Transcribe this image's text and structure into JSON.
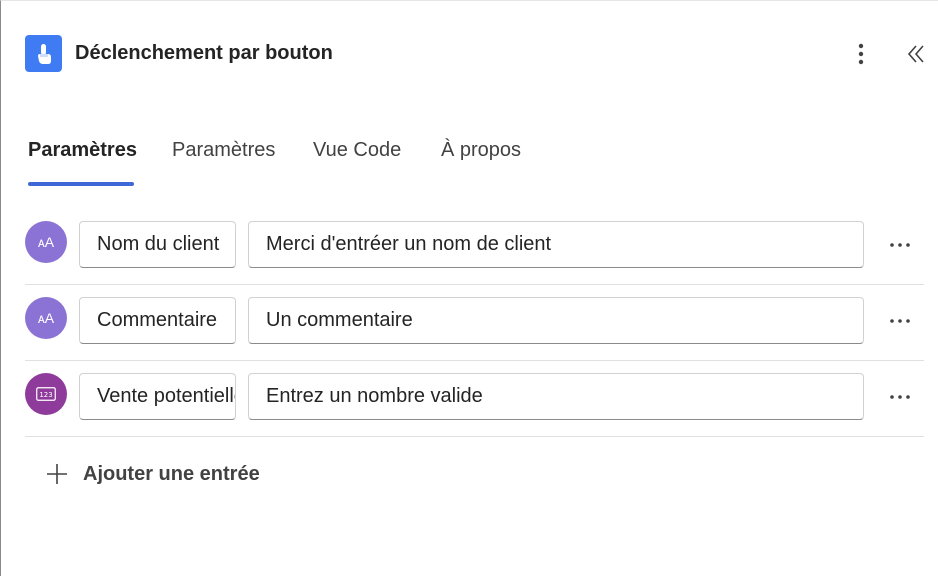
{
  "header": {
    "title": "Déclenchement par bouton",
    "icon": "touch-hand-icon",
    "accent_color": "#3f7cf4"
  },
  "tabs": [
    {
      "label": "Paramètres",
      "active": true
    },
    {
      "label": "Paramètres",
      "active": false
    },
    {
      "label": "Vue Code",
      "active": false
    },
    {
      "label": "À propos",
      "active": false
    }
  ],
  "inputs": [
    {
      "type_icon": "text-type-icon",
      "type_glyph": "ᴀA",
      "name": "Nom du client",
      "value": "Merci d'entréer un nom de client"
    },
    {
      "type_icon": "text-type-icon",
      "type_glyph": "ᴀA",
      "name": "Commentaire",
      "value": "Un commentaire"
    },
    {
      "type_icon": "number-type-icon",
      "type_glyph": "123",
      "name": "Vente potentielle",
      "value": "Entrez un nombre valide"
    }
  ],
  "add_entry": {
    "label": "Ajouter une entrée"
  }
}
